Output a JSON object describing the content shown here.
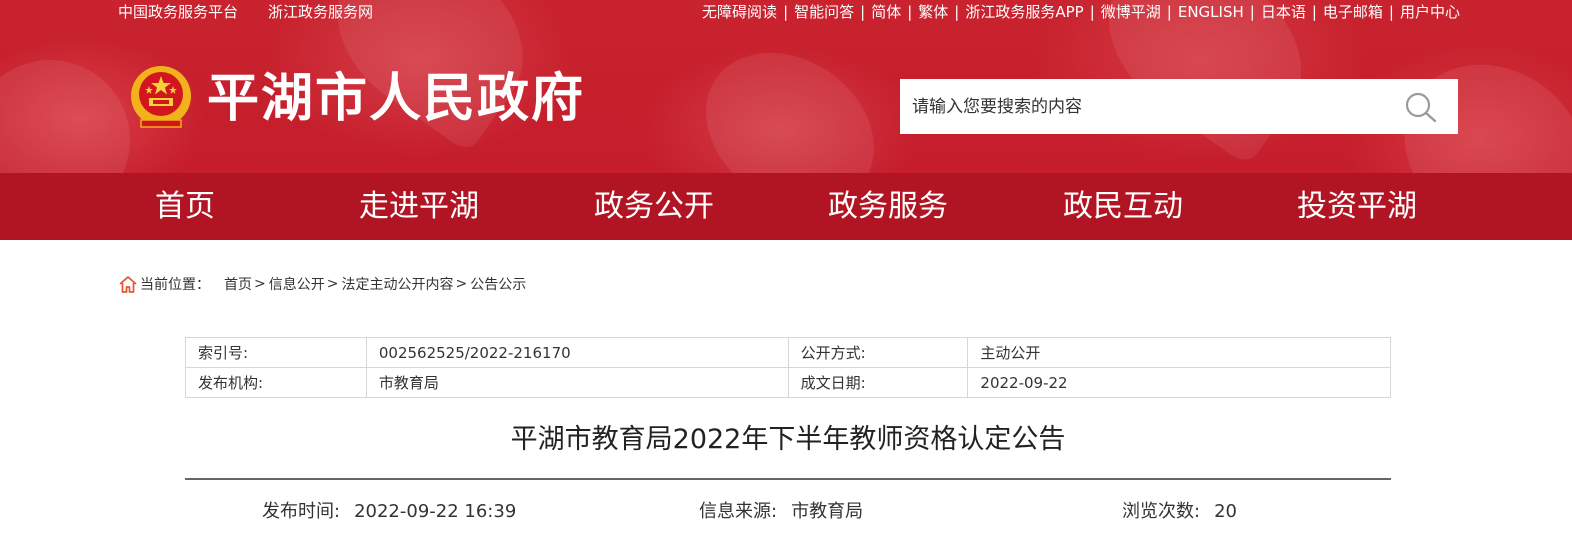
{
  "topbar": {
    "left_links": [
      "中国政务服务平台",
      "浙江政务服务网"
    ],
    "right_links": [
      "无障碍阅读",
      "智能问答",
      "简体",
      "繁体",
      "浙江政务服务APP",
      "微博平湖",
      "ENGLISH",
      "日本语",
      "电子邮箱",
      "用户中心"
    ],
    "separator": "|"
  },
  "header": {
    "site_title": "平湖市人民政府",
    "emblem_icon": "national-emblem-icon"
  },
  "search": {
    "placeholder": "请输入您要搜索的内容",
    "button_icon": "search-icon"
  },
  "nav": {
    "items": [
      "首页",
      "走进平湖",
      "政务公开",
      "政务服务",
      "政民互动",
      "投资平湖"
    ]
  },
  "breadcrumb": {
    "icon": "home-icon",
    "label": "当前位置：",
    "items": [
      "首页",
      "信息公开",
      "法定主动公开内容",
      "公告公示"
    ],
    "separator": ">"
  },
  "meta": {
    "rows": [
      {
        "k1": "索引号:",
        "v1": "002562525/2022-216170",
        "k2": "公开方式:",
        "v2": "主动公开"
      },
      {
        "k1": "发布机构:",
        "v1": "市教育局",
        "k2": "成文日期:",
        "v2": "2022-09-22"
      }
    ]
  },
  "article": {
    "title": "平湖市教育局2022年下半年教师资格认定公告",
    "publish_time_label": "发布时间:",
    "publish_time": "2022-09-22 16:39",
    "source_label": "信息来源:",
    "source": "市教育局",
    "views_label": "浏览次数:",
    "views": "20"
  },
  "colors": {
    "banner_red": "#c8232f",
    "nav_red": "#b11423",
    "white": "#ffffff",
    "text": "#333333"
  }
}
